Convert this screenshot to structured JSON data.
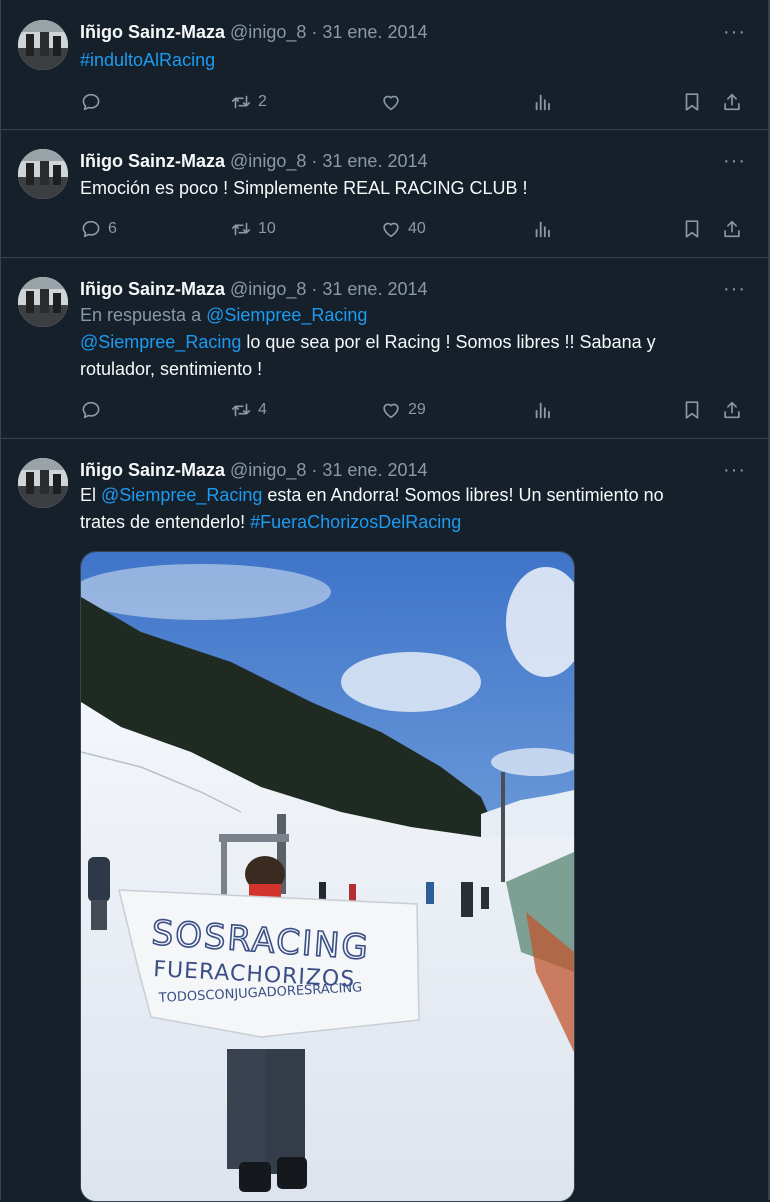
{
  "tweets": [
    {
      "author": "Iñigo Sainz-Maza",
      "handle": "@inigo_8",
      "date": "31 ene. 2014",
      "text": "#indultoAlRacing",
      "stats": {
        "replies": "",
        "retweets": "2",
        "likes": ""
      }
    },
    {
      "author": "Iñigo Sainz-Maza",
      "handle": "@inigo_8",
      "date": "31 ene. 2014",
      "text": "Emoción es poco ! Simplemente REAL RACING CLUB !",
      "stats": {
        "replies": "6",
        "retweets": "10",
        "likes": "40"
      }
    },
    {
      "author": "Iñigo Sainz-Maza",
      "handle": "@inigo_8",
      "date": "31 ene. 2014",
      "reply_prefix": "En respuesta a",
      "reply_handle": "@Siempree_Racing",
      "mention": "@Siempree_Racing",
      "text_line1": "lo que sea por el Racing ! Somos libres !! Sabana y",
      "text_line2": "rotulador, sentimiento !",
      "stats": {
        "replies": "",
        "retweets": "4",
        "likes": "29"
      }
    },
    {
      "author": "Iñigo Sainz-Maza",
      "handle": "@inigo_8",
      "date": "31 ene. 2014",
      "text_pre": "El",
      "mention": "@Siempree_Racing",
      "text_mid": "esta en Andorra! Somos libres! Un sentimiento no",
      "text_line2": "trates de entenderlo!",
      "hashtag": "#FueraChorizosDelRacing",
      "media": {
        "banner_line1": "SOSRACING",
        "banner_line2": "FUERACHORIZOS",
        "banner_line3": "TODOSCONJUGADORESRACING"
      }
    }
  ],
  "icons": [
    "reply-icon",
    "retweet-icon",
    "like-icon",
    "views-icon",
    "bookmark-icon",
    "share-icon",
    "more-icon"
  ],
  "colors": {
    "background": "#15202b",
    "link": "#1d9bf0",
    "muted": "#8b98a5",
    "text": "#f7f9f9",
    "border": "#38444d"
  }
}
